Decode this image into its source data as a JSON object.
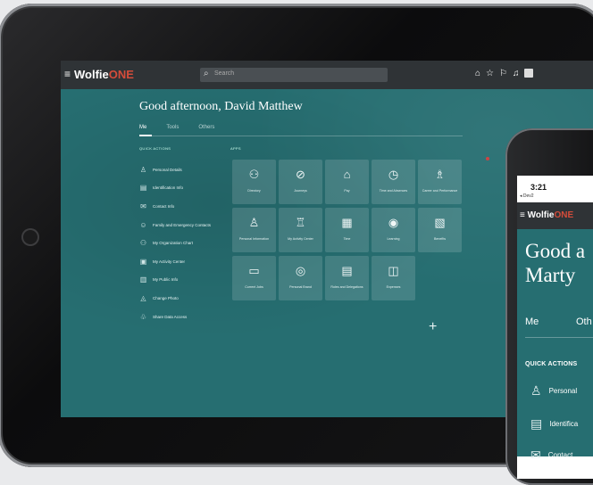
{
  "tablet": {
    "brand": {
      "prefix": "Wolfie",
      "suffix": "ONE"
    },
    "menu_glyph": "≡",
    "search": {
      "icon": "⌕",
      "placeholder": "Search"
    },
    "toolbar_icons": [
      "home-icon",
      "star-icon",
      "flag-icon",
      "bell-icon",
      "user-icon"
    ],
    "greeting": "Good afternoon, David Matthew",
    "tabs": [
      "Me",
      "Tools",
      "Others"
    ],
    "quick_actions_heading": "QUICK ACTIONS",
    "apps_heading": "APPS",
    "quick_actions": [
      {
        "label": "Personal Details",
        "icon": "user-icon"
      },
      {
        "label": "Identification Info",
        "icon": "id-card-icon"
      },
      {
        "label": "Contact Info",
        "icon": "mail-icon"
      },
      {
        "label": "Family and Emergency Contacts",
        "icon": "family-icon"
      },
      {
        "label": "My Organization Chart",
        "icon": "org-chart-icon"
      },
      {
        "label": "My Activity Center",
        "icon": "activity-icon"
      },
      {
        "label": "My Public Info",
        "icon": "public-info-icon"
      },
      {
        "label": "Change Photo",
        "icon": "camera-icon"
      },
      {
        "label": "Share Data Access",
        "icon": "share-icon"
      }
    ],
    "apps": [
      [
        {
          "label": "Directory",
          "icon": "org-icon"
        },
        {
          "label": "Journeys",
          "icon": "compass-icon"
        },
        {
          "label": "Pay",
          "icon": "bank-icon"
        },
        {
          "label": "Time and Absences",
          "icon": "clock-icon"
        },
        {
          "label": "Career and Performance",
          "icon": "people-icon"
        }
      ],
      [
        {
          "label": "Personal Information",
          "icon": "person-lock-icon"
        },
        {
          "label": "My Activity Center",
          "icon": "podium-icon"
        },
        {
          "label": "Time",
          "icon": "calendar-icon"
        },
        {
          "label": "Learning",
          "icon": "play-icon"
        },
        {
          "label": "Benefits",
          "icon": "gift-icon"
        }
      ],
      [
        {
          "label": "Current Jobs",
          "icon": "briefcase-icon"
        },
        {
          "label": "Personal Brand",
          "icon": "badge-icon"
        },
        {
          "label": "Roles and Delegations",
          "icon": "document-icon"
        },
        {
          "label": "Expenses",
          "icon": "wallet-icon"
        }
      ]
    ],
    "add_glyph": "+"
  },
  "phone": {
    "time": "3:21",
    "back_label": "◂ Dev2",
    "brand": {
      "prefix": "Wolfie",
      "suffix": "ONE"
    },
    "greeting_line1": "Good a",
    "greeting_line2": "Marty",
    "tabs": [
      "Me",
      "Oth"
    ],
    "quick_actions_heading": "QUICK ACTIONS",
    "quick_actions": [
      {
        "label": "Personal",
        "icon": "user-icon"
      },
      {
        "label": "Identifica",
        "icon": "id-card-icon"
      },
      {
        "label": "Contact",
        "icon": "mail-icon"
      }
    ]
  },
  "colors": {
    "teal": "#266e71",
    "topbar": "#2f3336",
    "brand_accent": "#d44c3a"
  }
}
